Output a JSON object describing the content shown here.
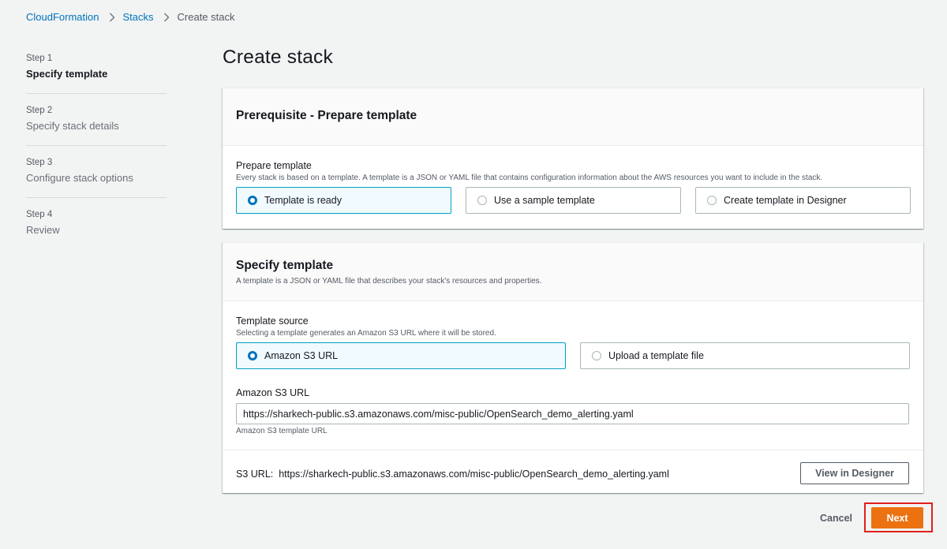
{
  "breadcrumb": {
    "items": [
      "CloudFormation",
      "Stacks",
      "Create stack"
    ]
  },
  "steps": [
    {
      "num": "Step 1",
      "title": "Specify template"
    },
    {
      "num": "Step 2",
      "title": "Specify stack details"
    },
    {
      "num": "Step 3",
      "title": "Configure stack options"
    },
    {
      "num": "Step 4",
      "title": "Review"
    }
  ],
  "active_step": 1,
  "page_title": "Create stack",
  "prerequisite": {
    "title": "Prerequisite - Prepare template",
    "field_label": "Prepare template",
    "field_desc": "Every stack is based on a template. A template is a JSON or YAML file that contains configuration information about the AWS resources you want to include in the stack.",
    "options": [
      "Template is ready",
      "Use a sample template",
      "Create template in Designer"
    ],
    "selected": "Template is ready"
  },
  "specify": {
    "title": "Specify template",
    "desc": "A template is a JSON or YAML file that describes your stack's resources and properties.",
    "source_label": "Template source",
    "source_desc": "Selecting a template generates an Amazon S3 URL where it will be stored.",
    "options": [
      "Amazon S3 URL",
      "Upload a template file"
    ],
    "selected": "Amazon S3 URL",
    "url_label": "Amazon S3 URL",
    "url_value": "https://sharkech-public.s3.amazonaws.com/misc-public/OpenSearch_demo_alerting.yaml",
    "url_hint": "Amazon S3 template URL",
    "s3_url_label": "S3 URL:",
    "s3_url_value": "https://sharkech-public.s3.amazonaws.com/misc-public/OpenSearch_demo_alerting.yaml",
    "view_designer": "View in Designer"
  },
  "footer": {
    "cancel": "Cancel",
    "next": "Next"
  },
  "colors": {
    "link": "#0073bb",
    "primary": "#ec7211",
    "selected_border": "#00a1c9",
    "highlight": "#e0201b"
  }
}
